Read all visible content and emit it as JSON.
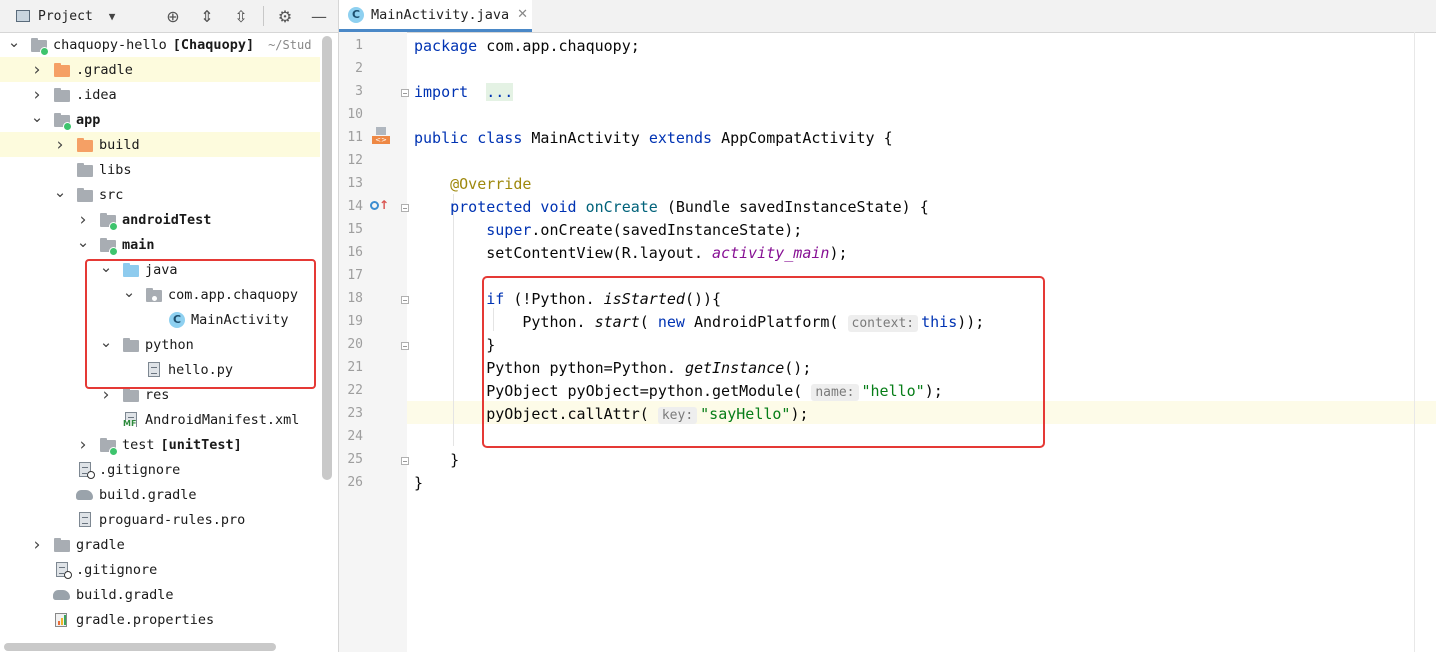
{
  "project_panel": {
    "view_label": "Project",
    "tree": [
      {
        "label": "chaquopy-hello",
        "extra": "[Chaquopy]",
        "extra2": "~/Stud",
        "arrow": "down",
        "icon": "module-folder",
        "depth": 0
      },
      {
        "label": ".gradle",
        "arrow": "right",
        "icon": "folder-orange",
        "depth": 1,
        "highlight": true
      },
      {
        "label": ".idea",
        "arrow": "right",
        "icon": "folder",
        "depth": 1
      },
      {
        "label": "app",
        "arrow": "down",
        "icon": "module-folder",
        "depth": 1,
        "bold": true
      },
      {
        "label": "build",
        "arrow": "right",
        "icon": "folder-orange",
        "depth": 2,
        "highlight": true
      },
      {
        "label": "libs",
        "arrow": "none",
        "icon": "folder",
        "depth": 2
      },
      {
        "label": "src",
        "arrow": "down",
        "icon": "folder",
        "depth": 2
      },
      {
        "label": "androidTest",
        "arrow": "right",
        "icon": "module-folder",
        "depth": 3,
        "bold": true
      },
      {
        "label": "main",
        "arrow": "down",
        "icon": "module-folder",
        "depth": 3,
        "bold": true
      },
      {
        "label": "java",
        "arrow": "down",
        "icon": "folder-blue",
        "depth": 4
      },
      {
        "label": "com.app.chaquopy",
        "arrow": "down",
        "icon": "package",
        "depth": 5
      },
      {
        "label": "MainActivity",
        "arrow": "none",
        "icon": "class",
        "depth": 6
      },
      {
        "label": "python",
        "arrow": "down",
        "icon": "folder",
        "depth": 4
      },
      {
        "label": "hello.py",
        "arrow": "none",
        "icon": "file",
        "depth": 5
      },
      {
        "label": "res",
        "arrow": "right",
        "icon": "folder",
        "depth": 4
      },
      {
        "label": "AndroidManifest.xml",
        "arrow": "none",
        "icon": "manifest",
        "depth": 4
      },
      {
        "label": "test",
        "extra": "[unitTest]",
        "arrow": "right",
        "icon": "module-folder",
        "depth": 3
      },
      {
        "label": ".gitignore",
        "arrow": "none",
        "icon": "gitignore",
        "depth": 2
      },
      {
        "label": "build.gradle",
        "arrow": "none",
        "icon": "gradle",
        "depth": 2
      },
      {
        "label": "proguard-rules.pro",
        "arrow": "none",
        "icon": "file",
        "depth": 2
      },
      {
        "label": "gradle",
        "arrow": "right",
        "icon": "folder",
        "depth": 1
      },
      {
        "label": ".gitignore",
        "arrow": "none",
        "icon": "gitignore",
        "depth": 1
      },
      {
        "label": "build.gradle",
        "arrow": "none",
        "icon": "gradle",
        "depth": 1
      },
      {
        "label": "gradle.properties",
        "arrow": "none",
        "icon": "properties",
        "depth": 1
      }
    ]
  },
  "editor": {
    "tab_label": "MainActivity.java",
    "tab_icon": "class-c-icon",
    "tab_icon_letter": "C",
    "current_line": "23",
    "lines": [
      {
        "n": "1",
        "tokens": [
          [
            "kw",
            "package"
          ],
          [
            "",
            "com.app.chaquopy;"
          ]
        ]
      },
      {
        "n": "2",
        "tokens": []
      },
      {
        "n": "3",
        "tokens": [
          [
            "kw",
            "import"
          ],
          [
            "",
            ""
          ],
          [
            "dots",
            "..."
          ]
        ]
      },
      {
        "n": "10",
        "tokens": []
      },
      {
        "n": "11",
        "tokens": [
          [
            "kw",
            "public class"
          ],
          [
            "",
            "MainActivity"
          ],
          [
            "kw",
            "extends"
          ],
          [
            "",
            "AppCompatActivity {"
          ]
        ]
      },
      {
        "n": "12",
        "tokens": []
      },
      {
        "n": "13",
        "tokens": [
          [
            "sp",
            "    "
          ],
          [
            "ann",
            "@Override"
          ]
        ]
      },
      {
        "n": "14",
        "tokens": [
          [
            "sp",
            "    "
          ],
          [
            "kw",
            "protected void"
          ],
          [
            "fn",
            "onCreate"
          ],
          [
            "",
            "(Bundle savedInstanceState) {"
          ]
        ]
      },
      {
        "n": "15",
        "tokens": [
          [
            "sp",
            "        "
          ],
          [
            "kw",
            "super"
          ],
          [
            "nosp",
            ".onCreate(savedInstanceState);"
          ]
        ]
      },
      {
        "n": "16",
        "tokens": [
          [
            "sp",
            "        "
          ],
          [
            "",
            "setContentView(R.layout."
          ],
          [
            "fld",
            "activity_main"
          ],
          [
            "nosp",
            ");"
          ]
        ]
      },
      {
        "n": "17",
        "tokens": []
      },
      {
        "n": "18",
        "tokens": [
          [
            "sp",
            "        "
          ],
          [
            "kw",
            "if"
          ],
          [
            "",
            "(!Python."
          ],
          [
            "it",
            "isStarted"
          ],
          [
            "nosp",
            "()){"
          ]
        ]
      },
      {
        "n": "19",
        "tokens": [
          [
            "sp",
            "            "
          ],
          [
            "",
            "Python."
          ],
          [
            "it",
            "start"
          ],
          [
            "nosp",
            "("
          ],
          [
            "kw",
            "new"
          ],
          [
            "",
            "AndroidPlatform("
          ],
          [
            "hint",
            "context:"
          ],
          [
            "kw",
            "this"
          ],
          [
            "nosp",
            "));"
          ]
        ]
      },
      {
        "n": "20",
        "tokens": [
          [
            "sp",
            "        "
          ],
          [
            "",
            "}"
          ]
        ]
      },
      {
        "n": "21",
        "tokens": [
          [
            "sp",
            "        "
          ],
          [
            "",
            "Python python=Python."
          ],
          [
            "it",
            "getInstance"
          ],
          [
            "nosp",
            "();"
          ]
        ]
      },
      {
        "n": "22",
        "tokens": [
          [
            "sp",
            "        "
          ],
          [
            "",
            "PyObject pyObject=python.getModule("
          ],
          [
            "hint",
            "name:"
          ],
          [
            "str",
            "\"hello\""
          ],
          [
            "nosp",
            ");"
          ]
        ]
      },
      {
        "n": "23",
        "tokens": [
          [
            "sp",
            "        "
          ],
          [
            "",
            "pyObject.callAttr("
          ],
          [
            "hint",
            "key:"
          ],
          [
            "str",
            "\"sayHello\""
          ],
          [
            "nosp",
            ");"
          ]
        ]
      },
      {
        "n": "24",
        "tokens": []
      },
      {
        "n": "25",
        "tokens": [
          [
            "sp",
            "    "
          ],
          [
            "",
            "}"
          ]
        ]
      },
      {
        "n": "26",
        "tokens": [
          [
            "",
            "}"
          ]
        ]
      }
    ]
  }
}
